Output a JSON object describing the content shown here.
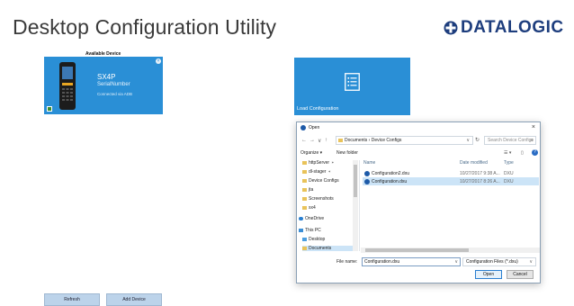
{
  "app": {
    "title": "Desktop Configuration Utility",
    "logo_text": "DATALOGIC",
    "brand_color": "#1d3d7d",
    "tile_color": "#2a8fd6"
  },
  "devices": {
    "section_label": "Available Device",
    "card": {
      "model": "SX4P",
      "serial": "SerialNumber",
      "connection": "Connected via ADB",
      "close_icon": "close-icon",
      "status_icon": "check-icon"
    }
  },
  "load": {
    "label": "Load Configuration",
    "icon": "list-document-icon"
  },
  "buttons": {
    "refresh": "Refresh",
    "add_device": "Add Device"
  },
  "dialog": {
    "title": "Open",
    "close": "×",
    "nav": {
      "back": "←",
      "forward": "→",
      "down": "∨",
      "up": "↑"
    },
    "address": "Documents  ›  Device Configs",
    "address_caret": "∨",
    "refresh_glyph": "↻",
    "search_placeholder": "Search Device Configs",
    "search_glyph": "⌕",
    "organize": "Organize ▾",
    "new_folder": "New folder",
    "view_glyph": "☰ ▾",
    "pane_glyph": "▯",
    "help_glyph": "?",
    "nav_items": [
      {
        "label": "httpServer",
        "pin": "✶",
        "icon": "folder-icon"
      },
      {
        "label": "dl-stager",
        "pin": "✶",
        "icon": "folder-icon"
      },
      {
        "label": "Device Configs",
        "pin": "",
        "icon": "folder-icon"
      },
      {
        "label": "jta",
        "pin": "",
        "icon": "folder-icon"
      },
      {
        "label": "Screenshots",
        "pin": "",
        "icon": "folder-icon"
      },
      {
        "label": "sx4",
        "pin": "",
        "icon": "folder-icon"
      },
      {
        "label": "OneDrive",
        "pin": "",
        "icon": "cloud-icon"
      },
      {
        "label": "This PC",
        "pin": "",
        "icon": "computer-icon"
      },
      {
        "label": "Desktop",
        "pin": "",
        "icon": "desktop-icon"
      },
      {
        "label": "Documents",
        "pin": "",
        "icon": "folder-icon"
      }
    ],
    "columns": {
      "name": "Name",
      "date": "Date modified",
      "type": "Type"
    },
    "files": [
      {
        "name": "Configuration2.dxu",
        "date": "10/27/2017 9:38 A...",
        "type": "DXU"
      },
      {
        "name": "Configuration.dxu",
        "date": "10/27/2017 8:26 A...",
        "type": "DXU"
      }
    ],
    "file_name_label": "File name:",
    "file_name_value": "Configuration.dxu",
    "file_type": "Configuration Files (*.dxu)",
    "open": "Open",
    "cancel": "Cancel"
  }
}
